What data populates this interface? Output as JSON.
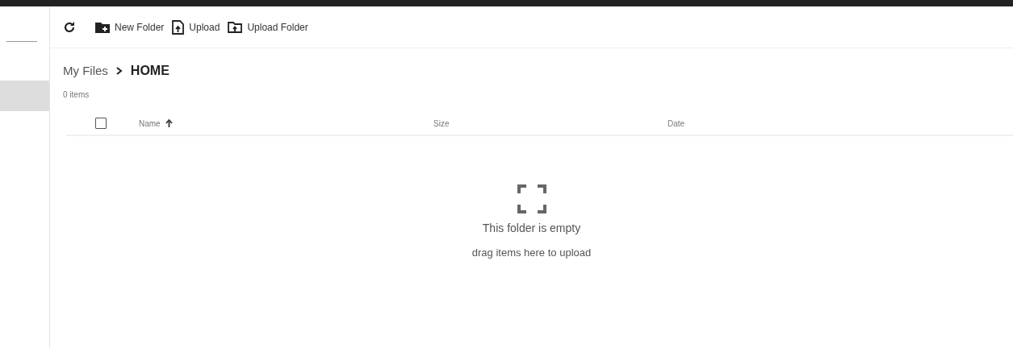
{
  "sidebar": {
    "items": [
      {
        "selected": true
      }
    ]
  },
  "toolbar": {
    "buttons": [
      {
        "kind": "refresh"
      },
      {
        "kind": "new-folder",
        "label": "New Folder"
      },
      {
        "kind": "upload",
        "label": "Upload"
      },
      {
        "kind": "upload-folder",
        "label": "Upload Folder"
      }
    ]
  },
  "breadcrumb": [
    {
      "label": "My Files",
      "current": false
    },
    {
      "label": "HOME",
      "current": true
    }
  ],
  "item_count": "0 items",
  "table": {
    "select_all": {
      "checked": false
    },
    "columns": [
      {
        "label": "Name",
        "sorted": true
      },
      {
        "label": "Size",
        "sorted": false
      },
      {
        "label": "Date",
        "sorted": false
      }
    ]
  },
  "empty_state": {
    "title": "This folder is empty",
    "hint": "drag items here to upload"
  }
}
